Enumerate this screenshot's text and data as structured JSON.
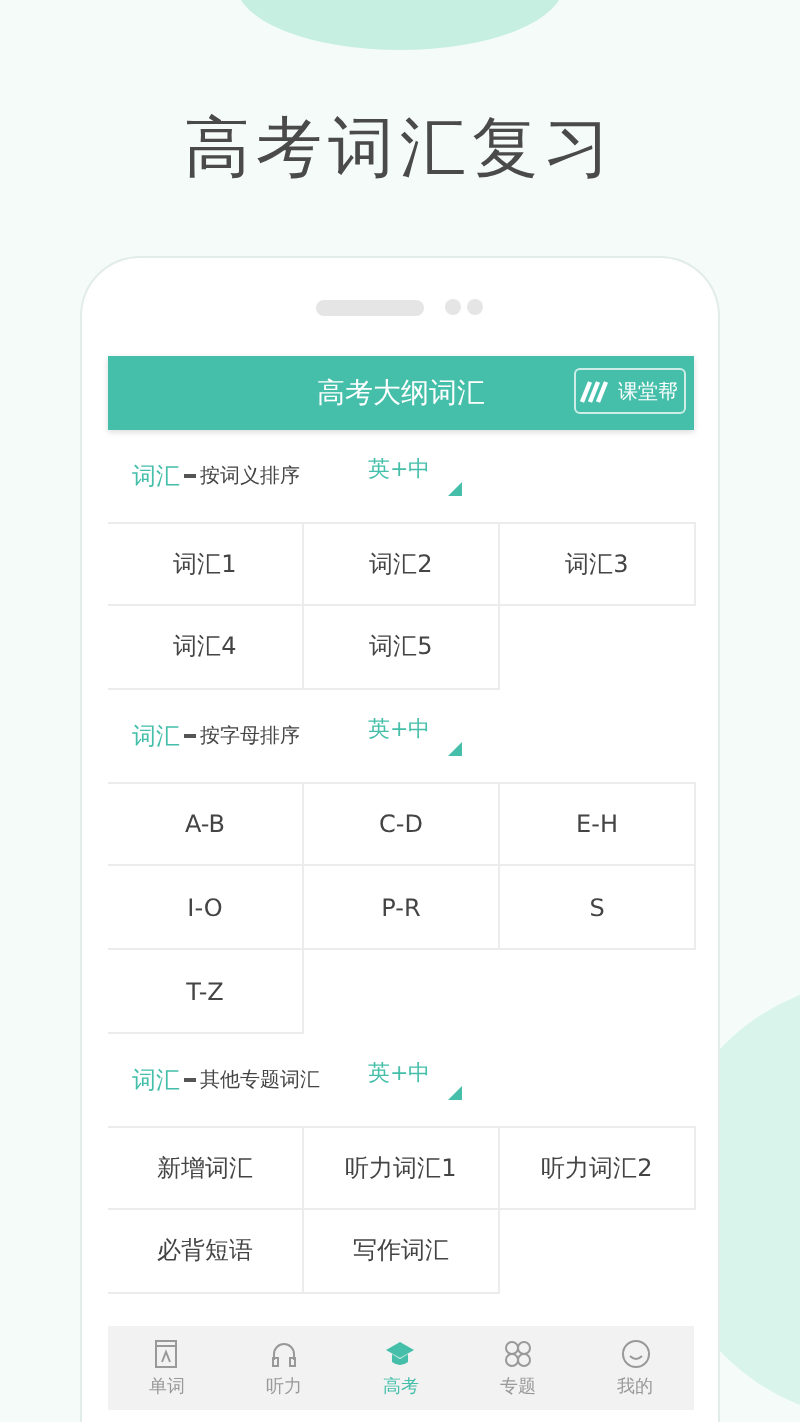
{
  "headline": "高考词汇复习",
  "screen": {
    "title": "高考大纲词汇",
    "logo_text": "课堂帮"
  },
  "sections": [
    {
      "title": "词汇",
      "subtitle": "按词义排序",
      "mode": "英+中",
      "items": [
        "词汇1",
        "词汇2",
        "词汇3",
        "词汇4",
        "词汇5"
      ]
    },
    {
      "title": "词汇",
      "subtitle": "按字母排序",
      "mode": "英+中",
      "items": [
        "A-B",
        "C-D",
        "E-H",
        "I-O",
        "P-R",
        "S",
        "T-Z"
      ]
    },
    {
      "title": "词汇",
      "subtitle": "其他专题词汇",
      "mode": "英+中",
      "items": [
        "新增词汇",
        "听力词汇1",
        "听力词汇2",
        "必背短语",
        "写作词汇"
      ]
    }
  ],
  "tabs": [
    {
      "label": "单词",
      "kind": "book",
      "selected": false
    },
    {
      "label": "听力",
      "kind": "headphones",
      "selected": false
    },
    {
      "label": "高考",
      "kind": "cap",
      "selected": true
    },
    {
      "label": "专题",
      "kind": "grid",
      "selected": false
    },
    {
      "label": "我的",
      "kind": "face",
      "selected": false
    }
  ]
}
